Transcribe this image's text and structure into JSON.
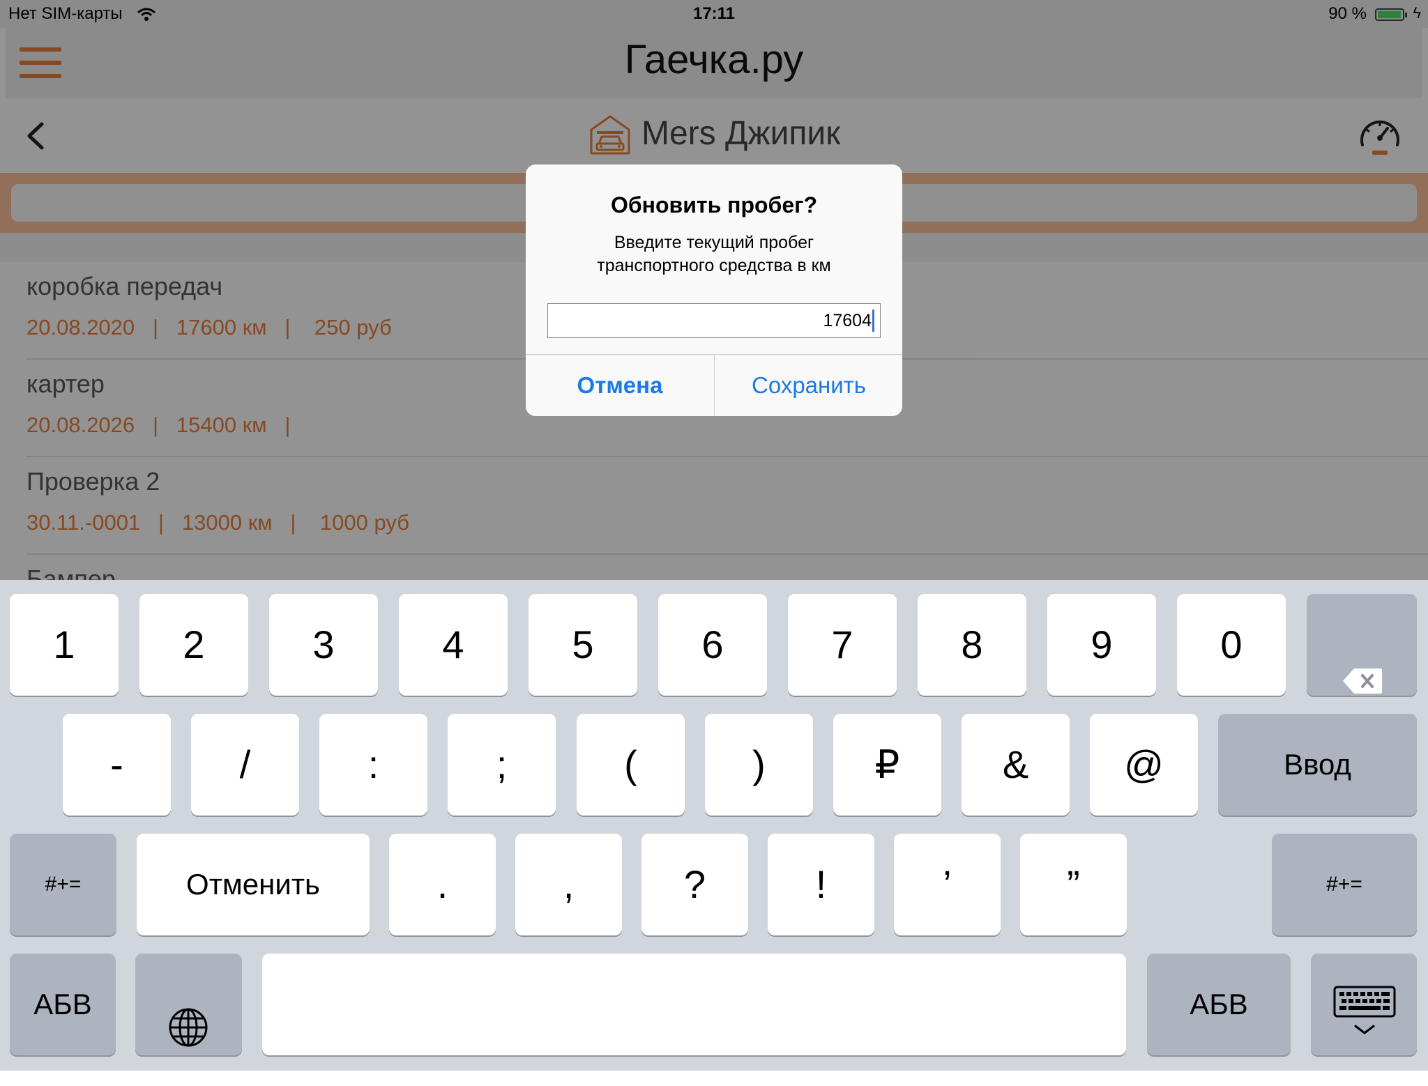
{
  "status_bar": {
    "carrier": "Нет SIM-карты",
    "time": "17:11",
    "battery": "90 %",
    "battery_level": 0.9
  },
  "app": {
    "title": "Гаечка.ру",
    "vehicle_name": "Mers Джипик"
  },
  "items": [
    {
      "name": "коробка передач",
      "details": "20.08.2020   |   17600 км   |    250 руб"
    },
    {
      "name": "картер",
      "details": "20.08.2026   |   15400 км   |"
    },
    {
      "name": "Проверка 2",
      "details": "30.11.-0001   |   13000 км   |    1000 руб"
    },
    {
      "name": "Бампер",
      "details": ""
    }
  ],
  "dialog": {
    "title": "Обновить пробег?",
    "message": "Введите текущий пробег\nтранспортного средства в км",
    "input_value": "17604",
    "cancel": "Отмена",
    "save": "Сохранить"
  },
  "keyboard": {
    "row1": [
      "1",
      "2",
      "3",
      "4",
      "5",
      "6",
      "7",
      "8",
      "9",
      "0"
    ],
    "row2": [
      "-",
      "/",
      ":",
      ";",
      "(",
      ")",
      "₽",
      "&",
      "@"
    ],
    "enter": "Ввод",
    "row3_left": "#+=",
    "undo": "Отменить",
    "row3": [
      ".",
      ",",
      "?",
      "!",
      "’",
      "”"
    ],
    "row3_right": "#+=",
    "abc_left": "АБВ",
    "abc_right": "АБВ",
    "icons": {
      "backspace": "backspace-icon",
      "globe": "globe-icon",
      "hide": "keyboard-hide-icon"
    }
  },
  "colors": {
    "accent": "#e07b39",
    "link": "#1a7ae6",
    "keyboard_bg": "#d1d5dc"
  }
}
